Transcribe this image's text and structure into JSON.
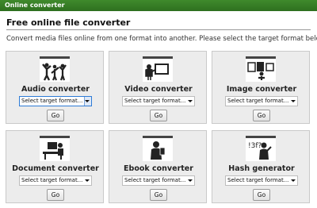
{
  "window": {
    "title": "Online converter"
  },
  "header": {
    "title": "Free online file converter"
  },
  "intro": "Convert media files online from one format into another. Please select the target format below:",
  "converters": [
    {
      "name": "Audio converter",
      "icon": "music-fans-icon",
      "select": "Select target format...",
      "button": "Go"
    },
    {
      "name": "Video converter",
      "icon": "movie-viewer-icon",
      "select": "Select target format...",
      "button": "Go"
    },
    {
      "name": "Image converter",
      "icon": "photo-frames-icon",
      "select": "Select target format...",
      "button": "Go"
    },
    {
      "name": "Document converter",
      "icon": "office-desk-icon",
      "select": "Select target format...",
      "button": "Go"
    },
    {
      "name": "Ebook converter",
      "icon": "reader-icon",
      "select": "Select target format...",
      "button": "Go"
    },
    {
      "name": "Hash generator",
      "icon": "hash-thinker-icon",
      "select": "Select target format...",
      "button": "Go"
    }
  ],
  "colors": {
    "titlebar": "#2e6f1f",
    "card_bg": "#ececec",
    "focus": "#2e7bd6"
  }
}
